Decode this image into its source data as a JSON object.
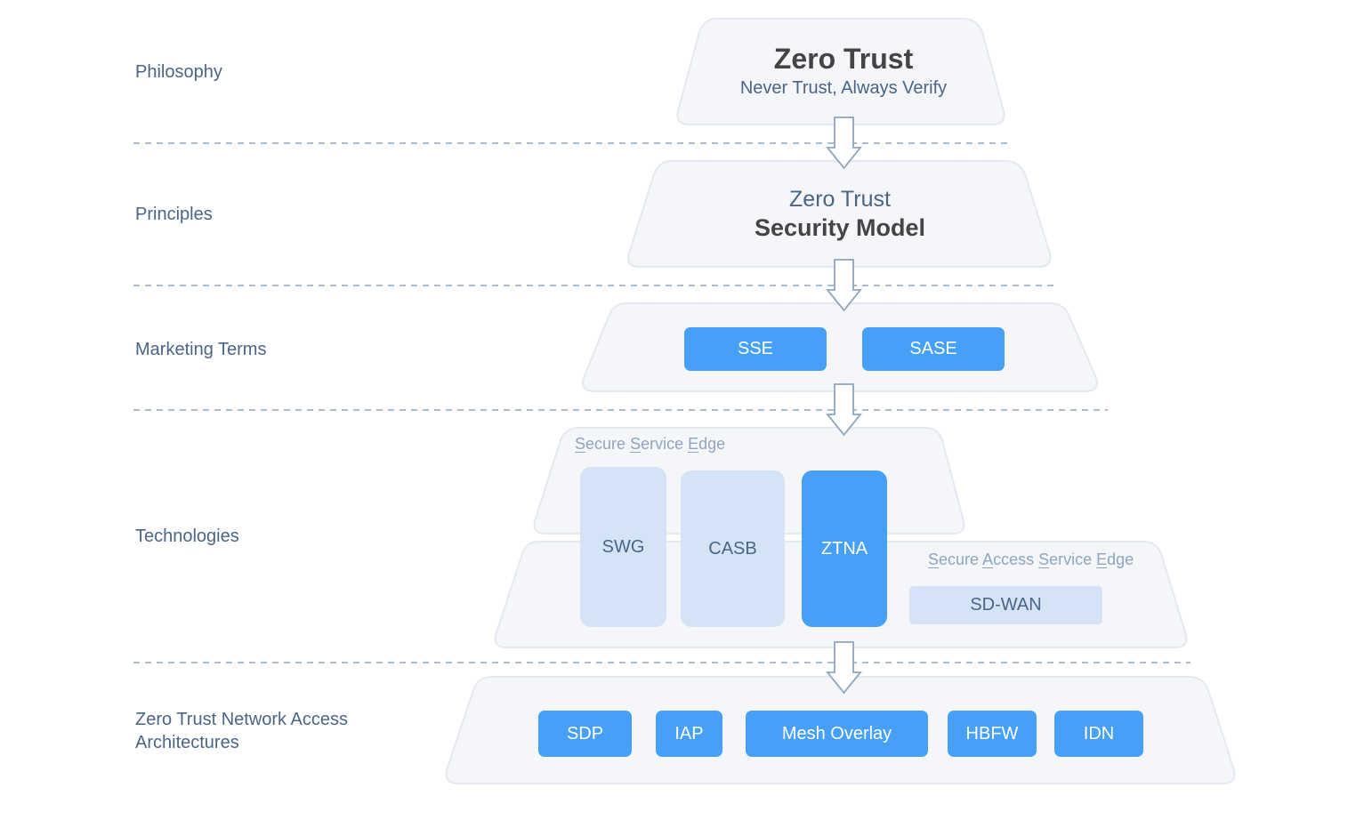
{
  "colors": {
    "tier_fill": "#f4f6fa",
    "tier_stroke": "#e4e9f0",
    "accent_blue": "#46a0f8",
    "light_blue": "#d4e4f6",
    "label_text": "#4a6585",
    "divider": "#8ea6bf",
    "arrow": "#8ea6bf"
  },
  "rows": [
    {
      "label": "Philosophy"
    },
    {
      "label": "Principles"
    },
    {
      "label": "Marketing Terms"
    },
    {
      "label": "Technologies"
    },
    {
      "label_line1": "Zero Trust Network Access",
      "label_line2": "Architectures"
    }
  ],
  "philosophy": {
    "title": "Zero Trust",
    "subtitle": "Never Trust, Always Verify"
  },
  "principles": {
    "line1": "Zero Trust",
    "line2": "Security Model"
  },
  "marketing": {
    "items": [
      "SSE",
      "SASE"
    ]
  },
  "technologies": {
    "sse_group": {
      "words": [
        "Secure",
        "Service",
        "Edge"
      ]
    },
    "sase_group": {
      "words": [
        "Secure",
        "Access",
        "Service",
        "Edge"
      ]
    },
    "items": [
      "SWG",
      "CASB",
      "ZTNA",
      "SD-WAN"
    ]
  },
  "architectures": {
    "items": [
      "SDP",
      "IAP",
      "Mesh Overlay",
      "HBFW",
      "IDN"
    ]
  }
}
